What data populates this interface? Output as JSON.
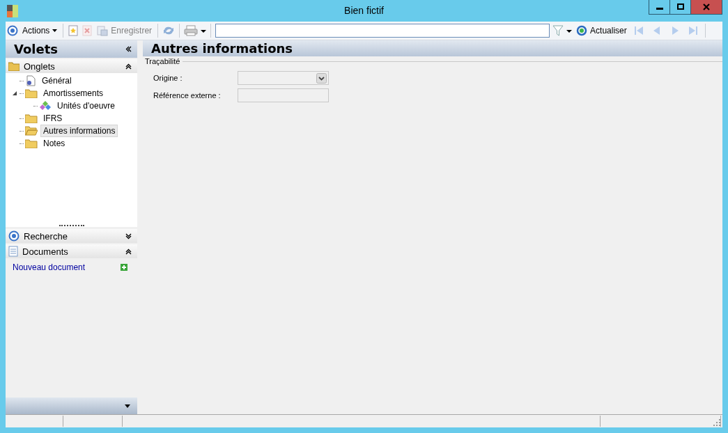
{
  "window": {
    "title": "Bien fictif"
  },
  "toolbar": {
    "actions_label": "Actions",
    "save": {
      "label": "Enregistrer",
      "disabled": true
    },
    "delete_disabled": true,
    "refresh_label": "Actualiser",
    "nav_disabled": true
  },
  "sidebar": {
    "title": "Volets",
    "panes": [
      {
        "kind": "tree",
        "title": "Onglets",
        "expanded": true
      },
      {
        "kind": "search",
        "title": "Recherche",
        "expanded": false
      },
      {
        "kind": "documents",
        "title": "Documents",
        "expanded": true,
        "link": "Nouveau document"
      }
    ],
    "tree": [
      {
        "label": "Général",
        "kind": "page",
        "selected": false
      },
      {
        "label": "Amortissements",
        "kind": "folder",
        "selected": false,
        "expanded": true,
        "children": [
          {
            "label": "Unités d'oeuvre",
            "kind": "units",
            "selected": false
          }
        ]
      },
      {
        "label": "IFRS",
        "kind": "folder",
        "selected": false
      },
      {
        "label": "Autres informations",
        "kind": "folder",
        "selected": true
      },
      {
        "label": "Notes",
        "kind": "folder",
        "selected": false
      }
    ]
  },
  "content": {
    "title": "Autres informations",
    "group": "Traçabilité",
    "fields": [
      {
        "label": "Origine :",
        "kind": "dropdown",
        "disabled": true
      },
      {
        "label": "Référence externe :",
        "kind": "text",
        "disabled": true
      }
    ]
  }
}
